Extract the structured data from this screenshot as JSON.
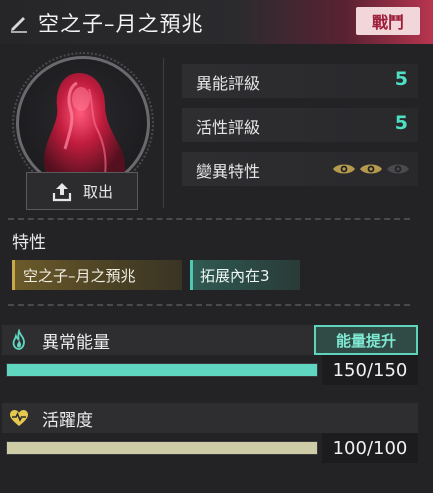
{
  "header": {
    "title": "空之子–月之預兆",
    "tag": "戰鬥",
    "accent": "#b8354f"
  },
  "portrait": {
    "takeout_label": "取出",
    "takeout_icon": "upload-icon"
  },
  "stats": {
    "anomaly_rating_label": "異能評級",
    "anomaly_rating_value": "5",
    "activity_rating_label": "活性評級",
    "activity_rating_value": "5",
    "mutation_label": "變異特性",
    "mutation_level": 2,
    "mutation_max": 3,
    "value_color": "#4ee0c4"
  },
  "traits": {
    "section_title": "特性",
    "items": [
      "空之子–月之預兆",
      "拓展內在3"
    ]
  },
  "anomaly_energy": {
    "label": "異常能量",
    "boost_label": "能量提升",
    "value_text": "150/150",
    "current": 150,
    "max": 150,
    "bar_color": "#5fd6bf"
  },
  "vitality": {
    "label": "活躍度",
    "value_text": "100/100",
    "current": 100,
    "max": 100,
    "bar_color": "#cfcca8"
  }
}
